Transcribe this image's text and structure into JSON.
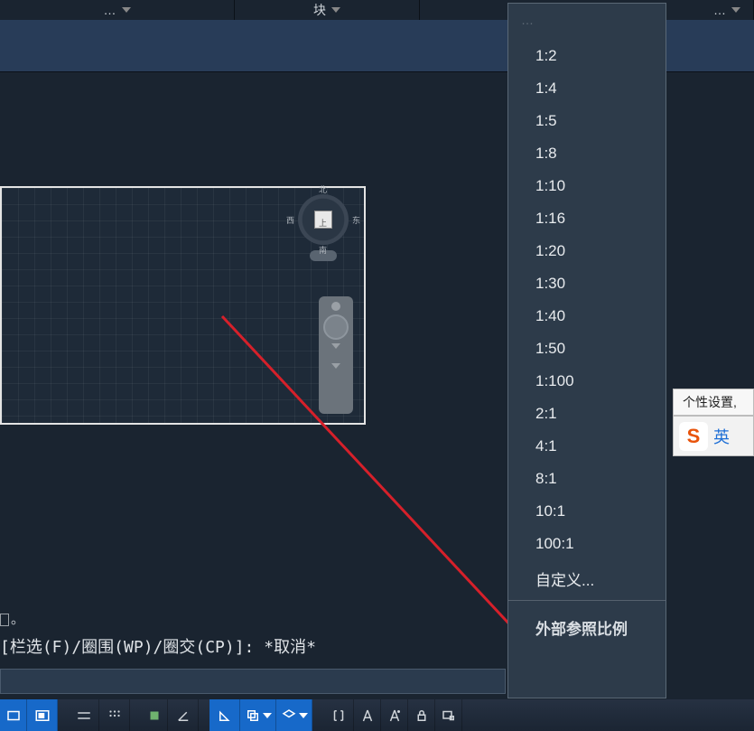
{
  "ribbon": {
    "group_left": "…",
    "group_block": "块",
    "group_right": "…"
  },
  "viewcube": {
    "north": "北",
    "south": "南",
    "east": "东",
    "west": "西",
    "face": "上"
  },
  "command": {
    "prev_suffix": "。",
    "line": "[栏选(F)/圈围(WP)/圈交(CP)]: *取消*"
  },
  "scale_menu": {
    "top_fade": "…",
    "items": [
      "1:2",
      "1:4",
      "1:5",
      "1:8",
      "1:10",
      "1:16",
      "1:20",
      "1:30",
      "1:40",
      "1:50",
      "1:100",
      "2:1",
      "4:1",
      "8:1",
      "10:1",
      "100:1",
      "自定义..."
    ],
    "bottom": "外部参照比例"
  },
  "ime": {
    "title": "个性设置,",
    "badge": "S",
    "lang": "英"
  }
}
